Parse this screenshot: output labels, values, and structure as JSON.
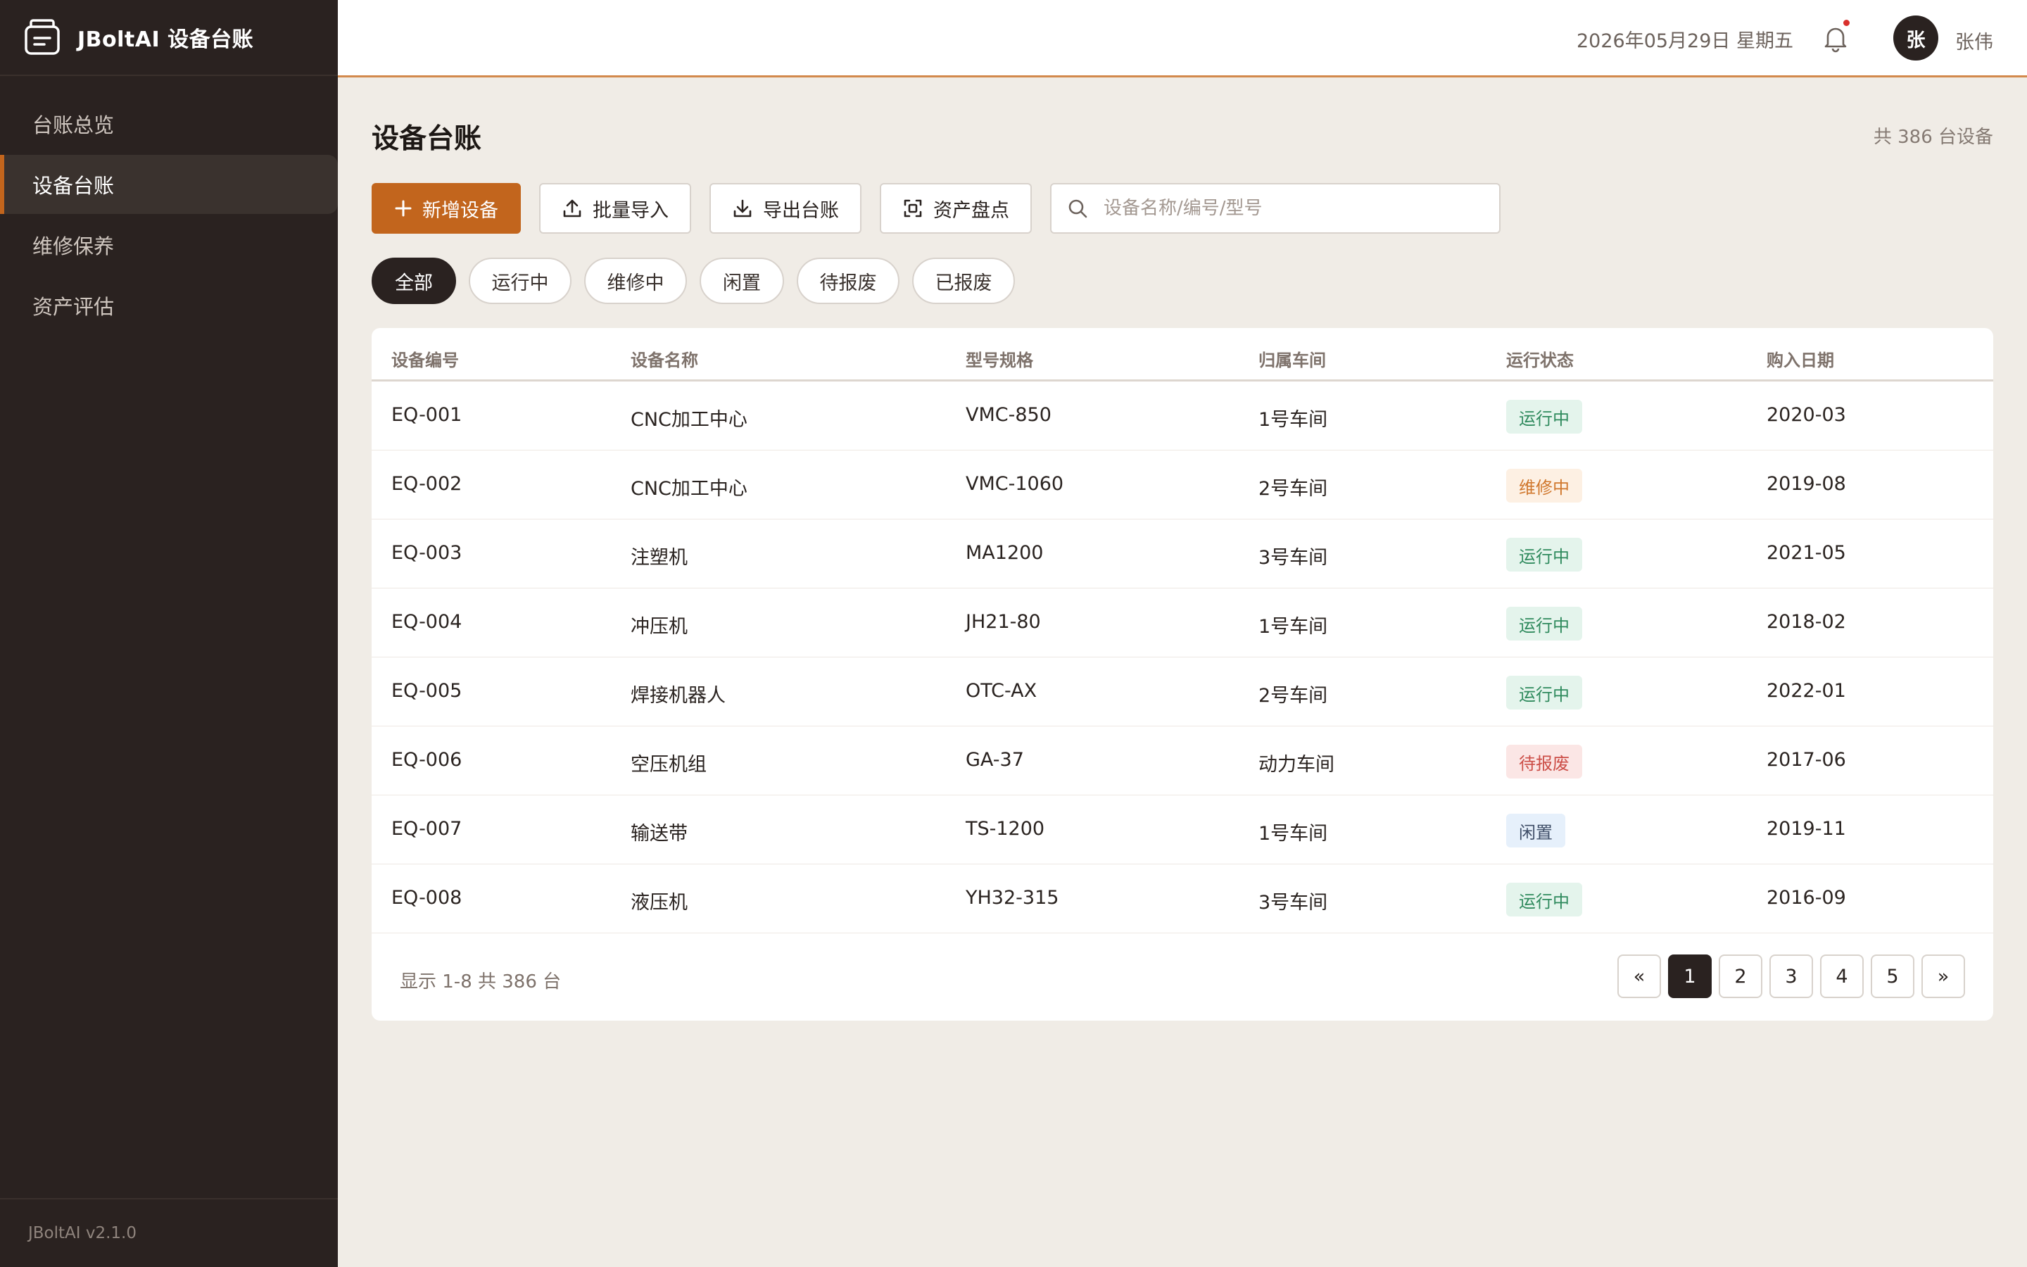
{
  "app": {
    "brand": "JBoltAI 设备台账",
    "version": "JBoltAI v2.1.0"
  },
  "sidebar": {
    "items": [
      {
        "label": "台账总览",
        "active": false
      },
      {
        "label": "设备台账",
        "active": true
      },
      {
        "label": "维修保养",
        "active": false
      },
      {
        "label": "资产评估",
        "active": false
      }
    ]
  },
  "header": {
    "date": "2026年05月29日 星期五",
    "avatar_initial": "张",
    "username": "张伟",
    "has_notification": true
  },
  "page": {
    "title": "设备台账",
    "count": "共 386 台设备"
  },
  "toolbar": {
    "add_label": "新增设备",
    "import_label": "批量导入",
    "export_label": "导出台账",
    "inventory_label": "资产盘点",
    "search_placeholder": "设备名称/编号/型号",
    "search_value": ""
  },
  "filters": [
    {
      "label": "全部",
      "active": true
    },
    {
      "label": "运行中",
      "active": false
    },
    {
      "label": "维修中",
      "active": false
    },
    {
      "label": "闲置",
      "active": false
    },
    {
      "label": "待报废",
      "active": false
    },
    {
      "label": "已报废",
      "active": false
    }
  ],
  "table": {
    "columns": [
      "设备编号",
      "设备名称",
      "型号规格",
      "归属车间",
      "运行状态",
      "购入日期"
    ],
    "rows": [
      {
        "id": "EQ-001",
        "name": "CNC加工中心",
        "model": "VMC-850",
        "workshop": "1号车间",
        "status": "运行中",
        "status_type": "running",
        "date": "2020-03"
      },
      {
        "id": "EQ-002",
        "name": "CNC加工中心",
        "model": "VMC-1060",
        "workshop": "2号车间",
        "status": "维修中",
        "status_type": "repair",
        "date": "2019-08"
      },
      {
        "id": "EQ-003",
        "name": "注塑机",
        "model": "MA1200",
        "workshop": "3号车间",
        "status": "运行中",
        "status_type": "running",
        "date": "2021-05"
      },
      {
        "id": "EQ-004",
        "name": "冲压机",
        "model": "JH21-80",
        "workshop": "1号车间",
        "status": "运行中",
        "status_type": "running",
        "date": "2018-02"
      },
      {
        "id": "EQ-005",
        "name": "焊接机器人",
        "model": "OTC-AX",
        "workshop": "2号车间",
        "status": "运行中",
        "status_type": "running",
        "date": "2022-01"
      },
      {
        "id": "EQ-006",
        "name": "空压机组",
        "model": "GA-37",
        "workshop": "动力车间",
        "status": "待报废",
        "status_type": "scrap",
        "date": "2017-06"
      },
      {
        "id": "EQ-007",
        "name": "输送带",
        "model": "TS-1200",
        "workshop": "1号车间",
        "status": "闲置",
        "status_type": "idle",
        "date": "2019-11"
      },
      {
        "id": "EQ-008",
        "name": "液压机",
        "model": "YH32-315",
        "workshop": "3号车间",
        "status": "运行中",
        "status_type": "running",
        "date": "2016-09"
      }
    ]
  },
  "pagination": {
    "summary": "显示 1-8 共 386 台",
    "prev": "«",
    "next": "»",
    "pages": [
      "1",
      "2",
      "3",
      "4",
      "5"
    ],
    "current": "1"
  },
  "colors": {
    "accent": "#c2651d",
    "sidebar_bg": "#2a2220",
    "running": "#2f8a5d",
    "repair": "#d0772c",
    "scrap": "#cc4e47",
    "idle": "#3d4c66"
  }
}
